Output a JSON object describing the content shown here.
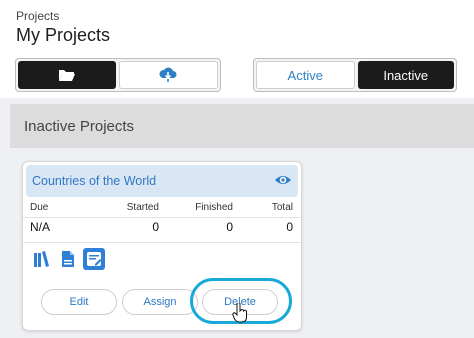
{
  "header": {
    "breadcrumb": "Projects",
    "title": "My Projects"
  },
  "toolbar": {
    "left_buttons": [
      {
        "icon": "folder-open-icon",
        "selected": true
      },
      {
        "icon": "cloud-download-icon",
        "selected": false
      }
    ],
    "filter_tabs": [
      {
        "label": "Active",
        "selected": false
      },
      {
        "label": "Inactive",
        "selected": true
      }
    ]
  },
  "section": {
    "title": "Inactive Projects"
  },
  "project_card": {
    "title": "Countries of the World",
    "view_icon": "eye-icon",
    "stats": {
      "headers": {
        "due": "Due",
        "started": "Started",
        "finished": "Finished",
        "total": "Total"
      },
      "values": {
        "due": "N/A",
        "started": "0",
        "finished": "0",
        "total": "0"
      }
    },
    "tool_icons": [
      "books-icon",
      "document-icon",
      "edit-note-icon"
    ],
    "actions": {
      "edit": "Edit",
      "assign": "Assign",
      "delete": "Delete"
    }
  },
  "colors": {
    "accent": "#2f7fc5",
    "highlight": "#18a9d8",
    "dark_button": "#1b1b1b"
  }
}
